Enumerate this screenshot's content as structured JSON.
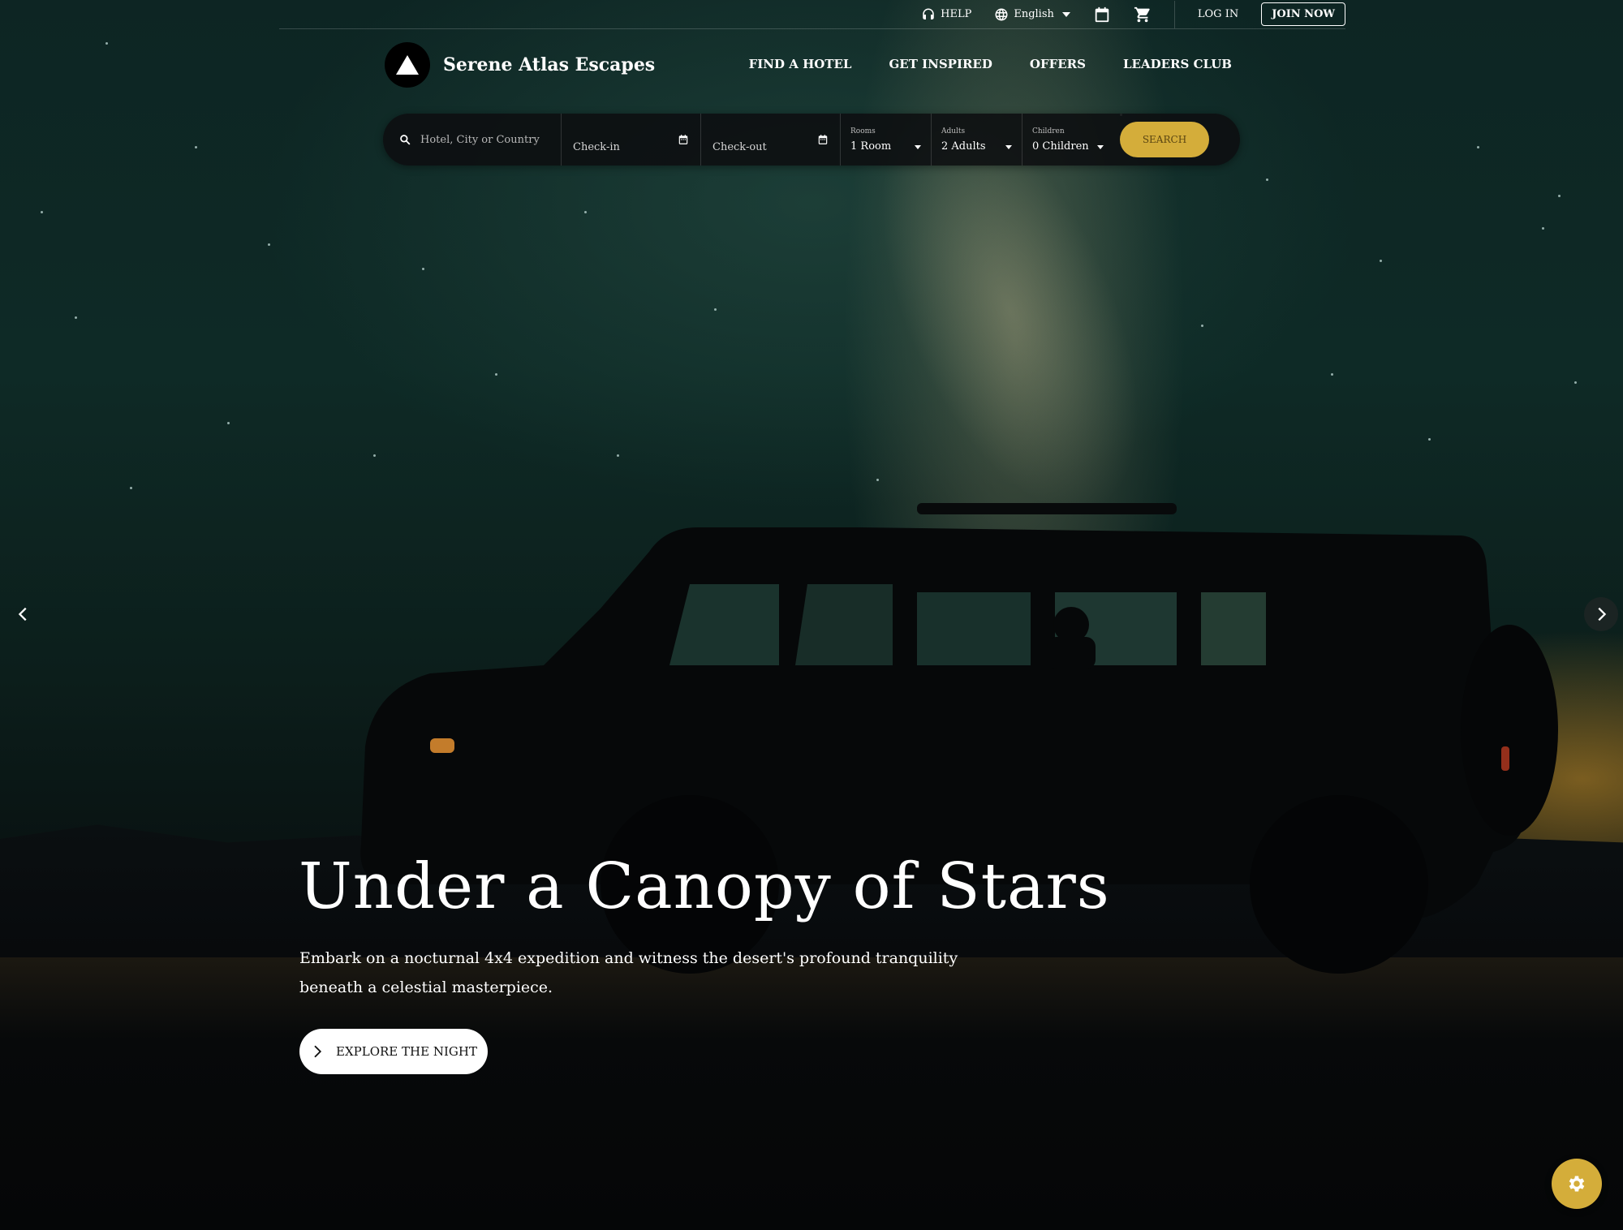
{
  "utility": {
    "help_label": "HELP",
    "language_label": "English",
    "login_label": "LOG IN",
    "join_label": "JOIN NOW"
  },
  "brand": {
    "name": "Serene Atlas Escapes"
  },
  "nav": {
    "items": [
      "FIND A HOTEL",
      "GET INSPIRED",
      "OFFERS",
      "LEADERS CLUB"
    ]
  },
  "search": {
    "destination_placeholder": "Hotel, City or Country",
    "checkin_label": "Check-in",
    "checkout_label": "Check-out",
    "rooms_label": "Rooms",
    "rooms_value": "1 Room",
    "adults_label": "Adults",
    "adults_value": "2 Adults",
    "children_label": "Children",
    "children_value": "0 Children",
    "button_label": "SEARCH"
  },
  "hero": {
    "title": "Under a Canopy of Stars",
    "subtitle": "Embark on a nocturnal 4x4 expedition and witness the desert's profound tranquility beneath a celestial masterpiece.",
    "cta_label": "EXPLORE THE NIGHT"
  },
  "colors": {
    "accent": "#d4ad3a",
    "search_bar_bg": "#0c0e10"
  }
}
